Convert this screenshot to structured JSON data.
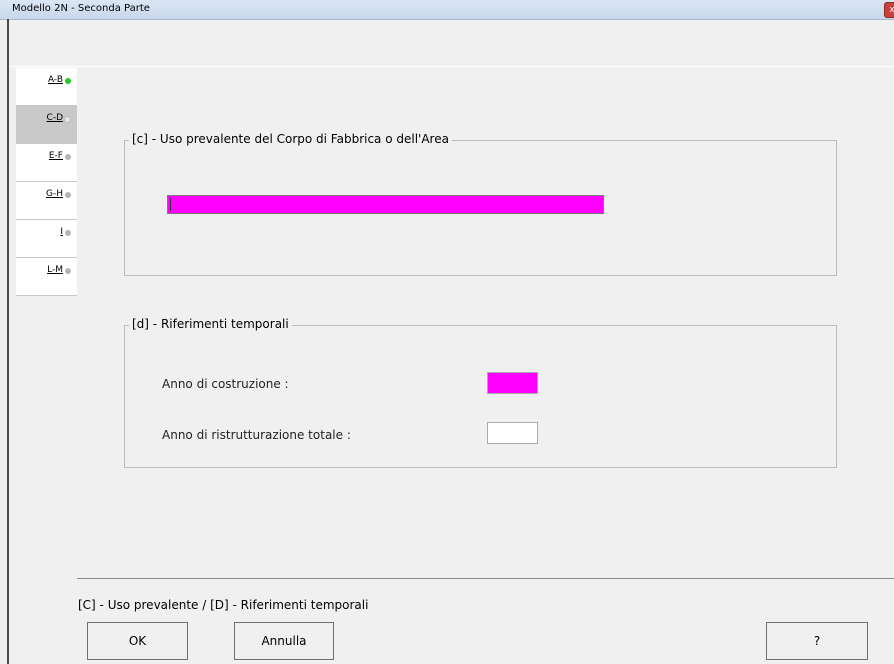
{
  "window": {
    "title": "Modello 2N - Seconda Parte",
    "close_glyph": "x"
  },
  "tabs": [
    {
      "label": "A-B",
      "status": "green"
    },
    {
      "label": "C-D",
      "status": "white",
      "selected": true
    },
    {
      "label": "E-F",
      "status": "gray"
    },
    {
      "label": "G-H",
      "status": "gray"
    },
    {
      "label": "I",
      "status": "gray"
    },
    {
      "label": "L-M",
      "status": "gray"
    }
  ],
  "section_c": {
    "legend": "[c] - Uso prevalente del Corpo di Fabbrica o dell'Area",
    "value": ""
  },
  "section_d": {
    "legend": "[d] - Riferimenti temporali",
    "anno_costruzione_label": "Anno di costruzione :",
    "anno_costruzione_value": "",
    "anno_ristrutturazione_label": "Anno di ristrutturazione totale :",
    "anno_ristrutturazione_value": ""
  },
  "status_text": "[C] - Uso prevalente / [D] - Riferimenti temporali",
  "buttons": {
    "ok": "OK",
    "cancel": "Annulla",
    "help": "?"
  },
  "colors": {
    "required_field": "#ff00ff",
    "status_ok": "#22cc22",
    "status_pending": "#b4b4b4"
  }
}
